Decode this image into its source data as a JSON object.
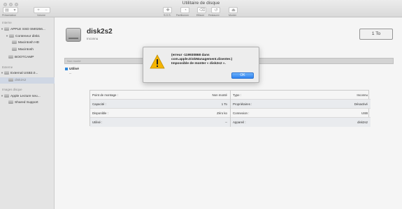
{
  "window": {
    "title": "Utilitaire de disque"
  },
  "toolbar": {
    "presentation_label": "Présentation",
    "volume_label": "Volume",
    "buttons": [
      {
        "label": "S.O.S.",
        "icon": "stethoscope-icon"
      },
      {
        "label": "Partitionner",
        "icon": "partition-icon"
      },
      {
        "label": "Effacer",
        "icon": "erase-icon"
      },
      {
        "label": "Restaurer",
        "icon": "restore-icon"
      },
      {
        "label": "Monter",
        "icon": "mount-icon"
      }
    ]
  },
  "sidebar": {
    "internal_section": "Interne",
    "external_section": "Externe",
    "images_section": "Images disque",
    "items": [
      {
        "label": "APPLE SSD SM0256..."
      },
      {
        "label": "Conteneur disk1"
      },
      {
        "label": "Macintosh HD"
      },
      {
        "label": "Macintosh"
      },
      {
        "label": "BOOTCAMP"
      },
      {
        "label": "External USB3.0..."
      },
      {
        "label": "disk2s2"
      },
      {
        "label": "Apple Lecture seu..."
      },
      {
        "label": "Shared Support"
      }
    ]
  },
  "main": {
    "disk_name": "disk2s2",
    "disk_subtitle": "Inconnu",
    "size_box": "1 To",
    "usage_bar_label": "Non monté",
    "legend_label": "Utilisé",
    "legend_value": "--",
    "info_left": [
      {
        "key": "Point de montage :",
        "value": "Non monté"
      },
      {
        "key": "Capacité :",
        "value": "1 To"
      },
      {
        "key": "Disponible :",
        "value": "Zéro ko"
      },
      {
        "key": "Utilisé :",
        "value": "--"
      }
    ],
    "info_right": [
      {
        "key": "Type :",
        "value": "Inconnu"
      },
      {
        "key": "Propriétaires :",
        "value": "Désactivé"
      },
      {
        "key": "Connexion :",
        "value": "USB"
      },
      {
        "key": "Appareil :",
        "value": "disk2s2"
      }
    ]
  },
  "alert": {
    "message": "(erreur -119930868 dans\ncom.apple.DiskManagement.disenter.)\nImpossible de monter « disk2s2 ».",
    "ok_label": "OK",
    "icon": "warning-icon"
  },
  "colors": {
    "accent": "#2f83f0",
    "warning": "#f5b400",
    "legend_used": "#2f8de4"
  }
}
